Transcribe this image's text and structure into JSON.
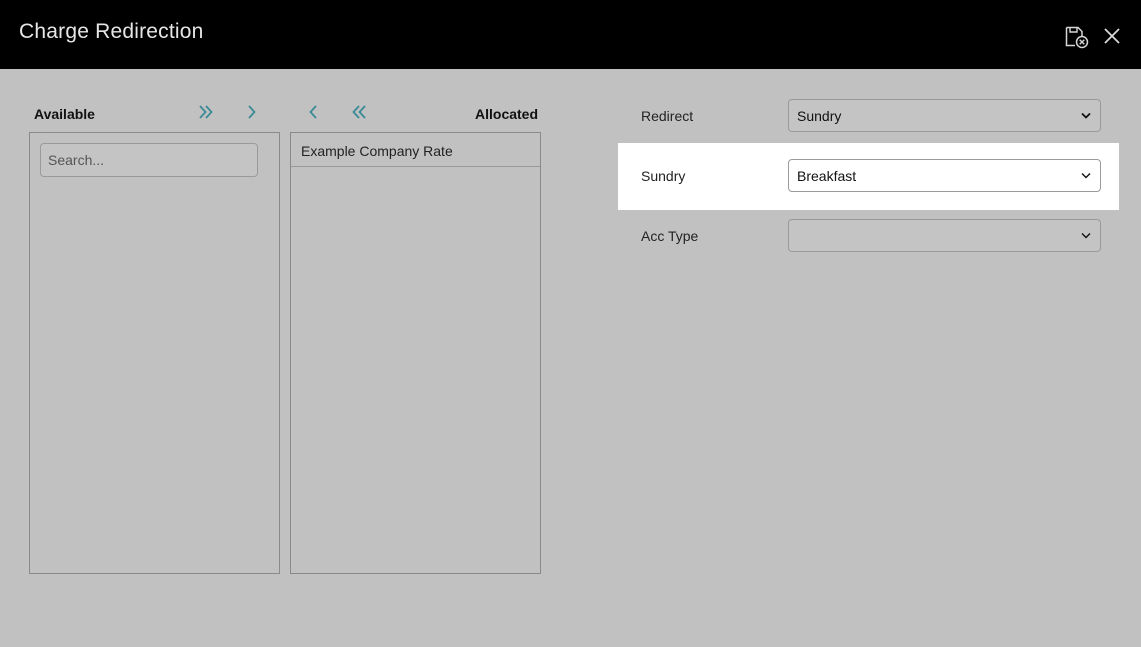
{
  "header": {
    "title": "Charge Redirection",
    "save_icon": "save-cancel-icon",
    "close_icon": "close-icon"
  },
  "allocator": {
    "available_label": "Available",
    "allocated_label": "Allocated",
    "search_placeholder": "Search...",
    "available_items": [],
    "allocated_items": [
      "Example Company Rate"
    ],
    "accent_color": "#3a8a96"
  },
  "form": {
    "redirect": {
      "label": "Redirect",
      "value": "Sundry"
    },
    "sundry": {
      "label": "Sundry",
      "value": "Breakfast"
    },
    "acc_type": {
      "label": "Acc Type",
      "value": ""
    }
  }
}
